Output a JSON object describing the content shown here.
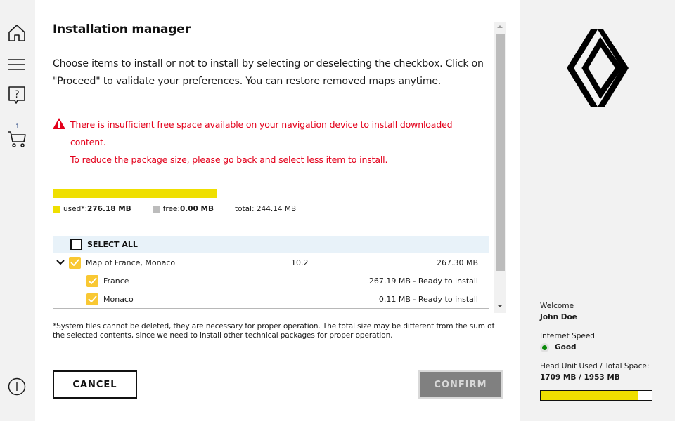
{
  "sidebar": {
    "items": [
      {
        "icon": "home-icon",
        "label": "Home"
      },
      {
        "icon": "menu-icon",
        "label": "Menu"
      },
      {
        "icon": "help-icon",
        "label": "Help"
      },
      {
        "icon": "cart-icon",
        "label": "Cart",
        "badge": "1"
      }
    ],
    "bottom_icon": "info-icon"
  },
  "main": {
    "title": "Installation manager",
    "intro": "Choose items to install or not to install by selecting or deselecting the checkbox. Click on \"Proceed\" to validate your preferences. You can restore removed maps anytime.",
    "warning": {
      "icon": "warning-icon",
      "line1": "There is insufficient free space available on your navigation device to install downloaded content.",
      "line2": "To reduce the package size, please go back and select less item to install.",
      "color": "#e3001b"
    },
    "storage": {
      "used_percent": 100,
      "used_label": "used*: ",
      "used_value": "276.18 MB",
      "free_label": "free: ",
      "free_value": "0.00 MB",
      "total_label": "total: 244.14 MB",
      "used_color": "#efdf00",
      "free_color": "#bcbcbc"
    },
    "list": {
      "select_all_label": "SELECT ALL",
      "select_all_checked": false,
      "items": [
        {
          "name": "Map of France, Monaco",
          "version": "10.2",
          "size": "267.30 MB",
          "checked": true,
          "expanded": true
        },
        {
          "name": "France",
          "size": "267.19 MB - Ready to install",
          "checked": true
        },
        {
          "name": "Monaco",
          "size": "0.11 MB - Ready to install",
          "checked": true
        }
      ]
    },
    "footnote": "*System files cannot be deleted, they are necessary for proper operation. The total size may be different from the sum of the selected contents, since we need to install other technical packages for proper operation.",
    "buttons": {
      "cancel": "CANCEL",
      "confirm": "CONFIRM"
    }
  },
  "right_panel": {
    "welcome_label": "Welcome",
    "user_name": "John Doe",
    "internet_label": "Internet Speed",
    "internet_status": "Good",
    "internet_status_color": "#0a8a0a",
    "head_unit_label": "Head Unit Used / Total Space:",
    "head_unit_value": "1709 MB / 1953 MB",
    "head_unit_used_fraction": 0.875
  }
}
